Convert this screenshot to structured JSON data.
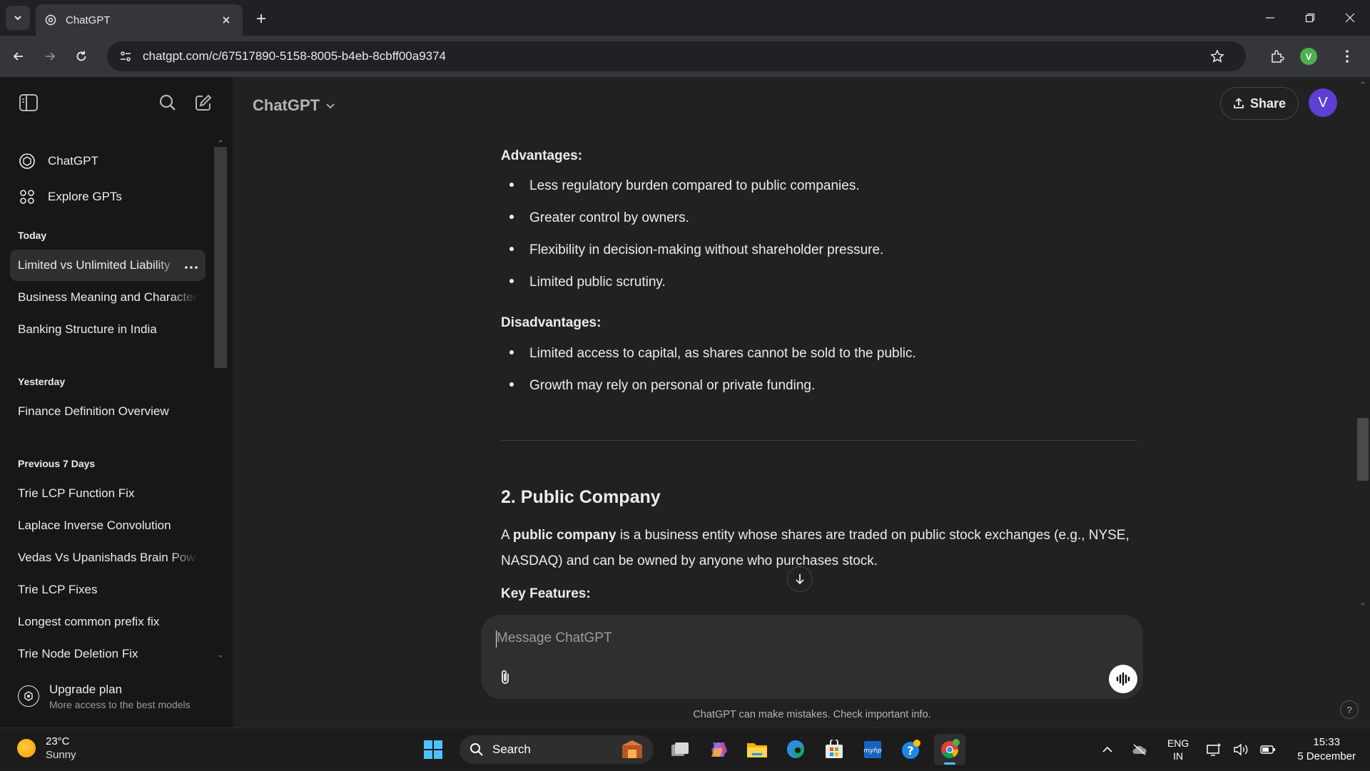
{
  "browser": {
    "tab_title": "ChatGPT",
    "url": "chatgpt.com/c/67517890-5158-8005-b4eb-8cbff00a9374",
    "profile_initial": "V"
  },
  "sidebar": {
    "top_items": [
      {
        "label": "ChatGPT",
        "icon": "chatgpt-logo-icon"
      },
      {
        "label": "Explore GPTs",
        "icon": "grid-icon"
      }
    ],
    "groups": [
      {
        "heading": "Today",
        "items": [
          "Limited vs Unlimited Liability",
          "Business Meaning and Characteristics",
          "Banking Structure in India"
        ]
      },
      {
        "heading": "Yesterday",
        "items": [
          "Finance Definition Overview"
        ]
      },
      {
        "heading": "Previous 7 Days",
        "items": [
          "Trie LCP Function Fix",
          "Laplace Inverse Convolution",
          "Vedas Vs Upanishads Brain Power",
          "Trie LCP Fixes",
          "Longest common prefix fix",
          "Trie Node Deletion Fix"
        ]
      }
    ],
    "active_item": "Limited vs Unlimited Liability",
    "upgrade": {
      "title": "Upgrade plan",
      "subtitle": "More access to the best models"
    }
  },
  "header": {
    "model": "ChatGPT",
    "share_label": "Share",
    "avatar_initial": "V"
  },
  "message": {
    "advantages_heading": "Advantages:",
    "advantages": [
      "Less regulatory burden compared to public companies.",
      "Greater control by owners.",
      "Flexibility in decision-making without shareholder pressure.",
      "Limited public scrutiny."
    ],
    "disadvantages_heading": "Disadvantages:",
    "disadvantages": [
      "Limited access to capital, as shares cannot be sold to the public.",
      "Growth may rely on personal or private funding."
    ],
    "section_title": "2. Public Company",
    "para_prefix": "A ",
    "para_bold": "public company",
    "para_rest": " is a business entity whose shares are traded on public stock exchanges (e.g., NYSE, NASDAQ) and can be owned by anyone who purchases stock.",
    "key_features_heading": "Key Features:"
  },
  "composer": {
    "placeholder": "Message ChatGPT",
    "disclaimer": "ChatGPT can make mistakes. Check important info.",
    "help": "?"
  },
  "taskbar": {
    "temperature": "23°C",
    "condition": "Sunny",
    "search_label": "Search",
    "lang_line1": "ENG",
    "lang_line2": "IN",
    "time": "15:33",
    "date": "5 December"
  }
}
